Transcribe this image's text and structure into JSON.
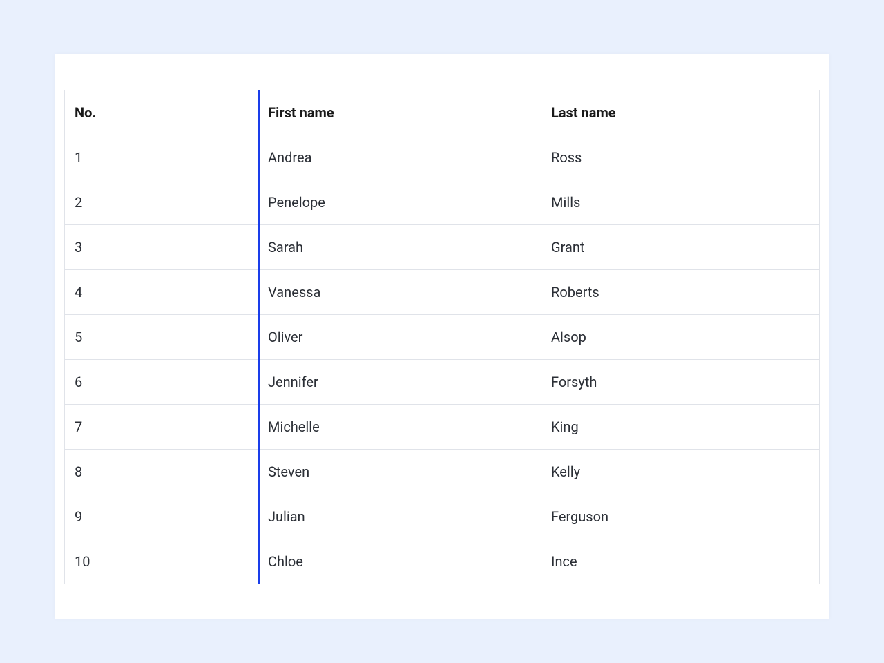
{
  "table": {
    "columns": [
      {
        "key": "no",
        "label": "No."
      },
      {
        "key": "first_name",
        "label": "First name"
      },
      {
        "key": "last_name",
        "label": "Last name"
      }
    ],
    "rows": [
      {
        "no": "1",
        "first_name": "Andrea",
        "last_name": "Ross"
      },
      {
        "no": "2",
        "first_name": "Penelope",
        "last_name": "Mills"
      },
      {
        "no": "3",
        "first_name": "Sarah",
        "last_name": "Grant"
      },
      {
        "no": "4",
        "first_name": "Vanessa",
        "last_name": "Roberts"
      },
      {
        "no": "5",
        "first_name": "Oliver",
        "last_name": "Alsop"
      },
      {
        "no": "6",
        "first_name": "Jennifer",
        "last_name": "Forsyth"
      },
      {
        "no": "7",
        "first_name": "Michelle",
        "last_name": "King"
      },
      {
        "no": "8",
        "first_name": "Steven",
        "last_name": "Kelly"
      },
      {
        "no": "9",
        "first_name": "Julian",
        "last_name": "Ferguson"
      },
      {
        "no": "10",
        "first_name": "Chloe",
        "last_name": "Ince"
      }
    ]
  }
}
